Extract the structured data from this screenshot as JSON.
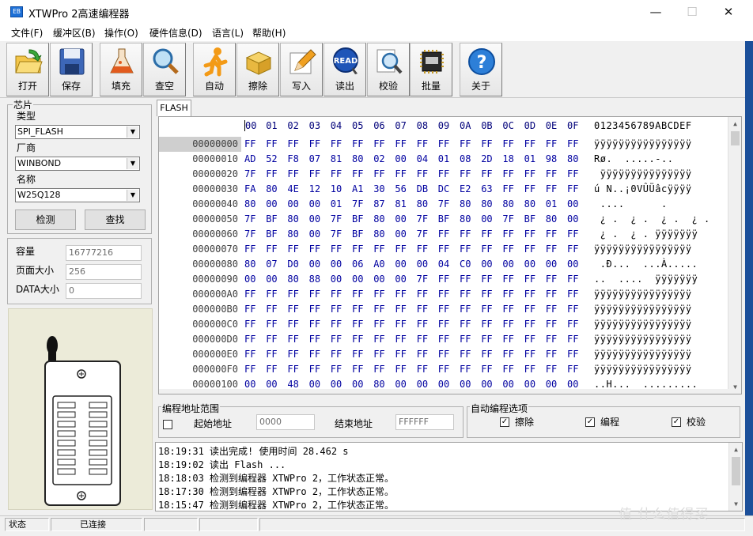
{
  "window": {
    "title": "XTWPro 2高速编程器",
    "icon_label": "EB",
    "minimize": "—",
    "maximize": "☐",
    "close": "✕"
  },
  "menu": [
    "文件(F)",
    "缓冲区(B)",
    "操作(O)",
    "硬件信息(D)",
    "语言(L)",
    "帮助(H)"
  ],
  "toolbar": {
    "buttons": [
      {
        "label": "打开",
        "icon": "open-folder-icon"
      },
      {
        "label": "保存",
        "icon": "floppy-disk-icon"
      },
      {
        "label": "填充",
        "icon": "flask-icon"
      },
      {
        "label": "查空",
        "icon": "magnifier-icon"
      },
      {
        "label": "自动",
        "icon": "running-man-icon"
      },
      {
        "label": "擦除",
        "icon": "box-icon"
      },
      {
        "label": "写入",
        "icon": "pencil-icon"
      },
      {
        "label": "读出",
        "icon": "read-icon",
        "badge": "READ"
      },
      {
        "label": "校验",
        "icon": "verify-magnifier-icon"
      },
      {
        "label": "批量",
        "icon": "chip-icon"
      },
      {
        "label": "关于",
        "icon": "help-icon",
        "badge": "?"
      }
    ]
  },
  "chip_panel": {
    "group_label": "芯片",
    "type_label": "类型",
    "type_value": "SPI_FLASH",
    "vendor_label": "厂商",
    "vendor_value": "WINBOND",
    "name_label": "名称",
    "name_value": "W25Q128",
    "detect_button": "检测",
    "search_button": "查找"
  },
  "info_panel": {
    "capacity_label": "容量",
    "capacity_value": "16777216",
    "page_size_label": "页面大小",
    "page_size_value": "256",
    "data_size_label": "DATA大小",
    "data_size_value": "0"
  },
  "hex": {
    "tab": "FLASH",
    "columns": [
      "00",
      "01",
      "02",
      "03",
      "04",
      "05",
      "06",
      "07",
      "08",
      "09",
      "0A",
      "0B",
      "0C",
      "0D",
      "0E",
      "0F"
    ],
    "ascii_header": "0123456789ABCDEF",
    "rows": [
      {
        "addr": "00000000",
        "bytes": [
          "FF",
          "FF",
          "FF",
          "FF",
          "FF",
          "FF",
          "FF",
          "FF",
          "FF",
          "FF",
          "FF",
          "FF",
          "FF",
          "FF",
          "FF",
          "FF"
        ],
        "ascii": "ÿÿÿÿÿÿÿÿÿÿÿÿÿÿÿÿ",
        "selected": true
      },
      {
        "addr": "00000010",
        "bytes": [
          "AD",
          "52",
          "F8",
          "07",
          "81",
          "80",
          "02",
          "00",
          "04",
          "01",
          "08",
          "2D",
          "18",
          "01",
          "98",
          "80"
        ],
        "ascii": "­Rø.  .....-..  "
      },
      {
        "addr": "00000020",
        "bytes": [
          "7F",
          "FF",
          "FF",
          "FF",
          "FF",
          "FF",
          "FF",
          "FF",
          "FF",
          "FF",
          "FF",
          "FF",
          "FF",
          "FF",
          "FF",
          "FF"
        ],
        "ascii": " ÿÿÿÿÿÿÿÿÿÿÿÿÿÿÿ"
      },
      {
        "addr": "00000030",
        "bytes": [
          "FA",
          "80",
          "4E",
          "12",
          "10",
          "A1",
          "30",
          "56",
          "DB",
          "DC",
          "E2",
          "63",
          "FF",
          "FF",
          "FF",
          "FF"
        ],
        "ascii": "ú N..¡0VÛÜâcÿÿÿÿ"
      },
      {
        "addr": "00000040",
        "bytes": [
          "80",
          "00",
          "00",
          "00",
          "01",
          "7F",
          "87",
          "81",
          "80",
          "7F",
          "80",
          "80",
          "80",
          "80",
          "01",
          "00"
        ],
        "ascii": " ....      .    "
      },
      {
        "addr": "00000050",
        "bytes": [
          "7F",
          "BF",
          "80",
          "00",
          "7F",
          "BF",
          "80",
          "00",
          "7F",
          "BF",
          "80",
          "00",
          "7F",
          "BF",
          "80",
          "00"
        ],
        "ascii": " ¿ .  ¿ .  ¿ .  ¿ ."
      },
      {
        "addr": "00000060",
        "bytes": [
          "7F",
          "BF",
          "80",
          "00",
          "7F",
          "BF",
          "80",
          "00",
          "7F",
          "FF",
          "FF",
          "FF",
          "FF",
          "FF",
          "FF",
          "FF"
        ],
        "ascii": " ¿ .  ¿ . ÿÿÿÿÿÿÿ"
      },
      {
        "addr": "00000070",
        "bytes": [
          "FF",
          "FF",
          "FF",
          "FF",
          "FF",
          "FF",
          "FF",
          "FF",
          "FF",
          "FF",
          "FF",
          "FF",
          "FF",
          "FF",
          "FF",
          "FF"
        ],
        "ascii": "ÿÿÿÿÿÿÿÿÿÿÿÿÿÿÿÿ"
      },
      {
        "addr": "00000080",
        "bytes": [
          "80",
          "07",
          "D0",
          "00",
          "00",
          "06",
          "A0",
          "00",
          "00",
          "04",
          "C0",
          "00",
          "00",
          "00",
          "00",
          "00"
        ],
        "ascii": " .Ð...  ...À....."
      },
      {
        "addr": "00000090",
        "bytes": [
          "00",
          "00",
          "80",
          "88",
          "00",
          "00",
          "00",
          "00",
          "7F",
          "FF",
          "FF",
          "FF",
          "FF",
          "FF",
          "FF",
          "FF"
        ],
        "ascii": "..  ....  ÿÿÿÿÿÿÿ"
      },
      {
        "addr": "000000A0",
        "bytes": [
          "FF",
          "FF",
          "FF",
          "FF",
          "FF",
          "FF",
          "FF",
          "FF",
          "FF",
          "FF",
          "FF",
          "FF",
          "FF",
          "FF",
          "FF",
          "FF"
        ],
        "ascii": "ÿÿÿÿÿÿÿÿÿÿÿÿÿÿÿÿ"
      },
      {
        "addr": "000000B0",
        "bytes": [
          "FF",
          "FF",
          "FF",
          "FF",
          "FF",
          "FF",
          "FF",
          "FF",
          "FF",
          "FF",
          "FF",
          "FF",
          "FF",
          "FF",
          "FF",
          "FF"
        ],
        "ascii": "ÿÿÿÿÿÿÿÿÿÿÿÿÿÿÿÿ"
      },
      {
        "addr": "000000C0",
        "bytes": [
          "FF",
          "FF",
          "FF",
          "FF",
          "FF",
          "FF",
          "FF",
          "FF",
          "FF",
          "FF",
          "FF",
          "FF",
          "FF",
          "FF",
          "FF",
          "FF"
        ],
        "ascii": "ÿÿÿÿÿÿÿÿÿÿÿÿÿÿÿÿ"
      },
      {
        "addr": "000000D0",
        "bytes": [
          "FF",
          "FF",
          "FF",
          "FF",
          "FF",
          "FF",
          "FF",
          "FF",
          "FF",
          "FF",
          "FF",
          "FF",
          "FF",
          "FF",
          "FF",
          "FF"
        ],
        "ascii": "ÿÿÿÿÿÿÿÿÿÿÿÿÿÿÿÿ"
      },
      {
        "addr": "000000E0",
        "bytes": [
          "FF",
          "FF",
          "FF",
          "FF",
          "FF",
          "FF",
          "FF",
          "FF",
          "FF",
          "FF",
          "FF",
          "FF",
          "FF",
          "FF",
          "FF",
          "FF"
        ],
        "ascii": "ÿÿÿÿÿÿÿÿÿÿÿÿÿÿÿÿ"
      },
      {
        "addr": "000000F0",
        "bytes": [
          "FF",
          "FF",
          "FF",
          "FF",
          "FF",
          "FF",
          "FF",
          "FF",
          "FF",
          "FF",
          "FF",
          "FF",
          "FF",
          "FF",
          "FF",
          "FF"
        ],
        "ascii": "ÿÿÿÿÿÿÿÿÿÿÿÿÿÿÿÿ"
      },
      {
        "addr": "00000100",
        "bytes": [
          "00",
          "00",
          "48",
          "00",
          "00",
          "00",
          "80",
          "00",
          "00",
          "00",
          "00",
          "00",
          "00",
          "00",
          "00",
          "00"
        ],
        "ascii": "..H...  ........."
      }
    ]
  },
  "address_range": {
    "group_label": "编程地址范围",
    "start_label": "起始地址",
    "start_value": "0000",
    "end_label": "结束地址",
    "end_value": "FFFFFF"
  },
  "auto_options": {
    "group_label": "自动编程选项",
    "items": [
      {
        "label": "擦除",
        "checked": "✓"
      },
      {
        "label": "编程",
        "checked": "✓"
      },
      {
        "label": "校验",
        "checked": "✓"
      }
    ]
  },
  "log": [
    "18:19:31 读出完成! 使用时间 28.462 s",
    "18:19:02 读出 Flash ...",
    "18:18:03 检测到编程器 XTWPro 2，工作状态正常。",
    "18:17:30 检测到编程器 XTWPro 2，工作状态正常。",
    "18:15:47 检测到编程器 XTWPro 2，工作状态正常。"
  ],
  "status": {
    "label": "状态",
    "connection": "已连接"
  },
  "watermark": "值 什么值得买",
  "colors": {
    "hex_text": "#0000a0",
    "selected_row": "#cfcfcf",
    "chip_bg": "#ecebd9"
  }
}
